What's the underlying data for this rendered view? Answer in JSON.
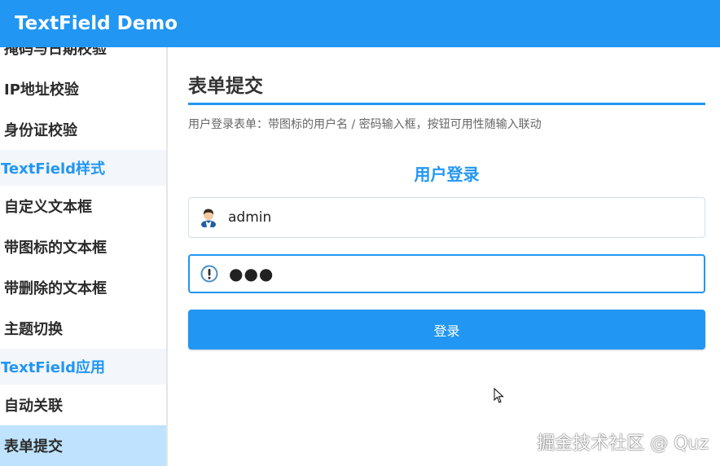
{
  "appbar": {
    "title": "TextField Demo"
  },
  "sidebar": {
    "items": [
      {
        "label": "掩码与日期校验",
        "type": "item"
      },
      {
        "label": "IP地址校验",
        "type": "item"
      },
      {
        "label": "身份证校验",
        "type": "item"
      },
      {
        "label": "TextField样式",
        "type": "header"
      },
      {
        "label": "自定义文本框",
        "type": "item"
      },
      {
        "label": "带图标的文本框",
        "type": "item"
      },
      {
        "label": "带删除的文本框",
        "type": "item"
      },
      {
        "label": "主题切换",
        "type": "item"
      },
      {
        "label": "TextField应用",
        "type": "header"
      },
      {
        "label": "自动关联",
        "type": "item"
      },
      {
        "label": "表单提交",
        "type": "item",
        "active": true
      }
    ]
  },
  "main": {
    "title": "表单提交",
    "description": "用户登录表单：带图标的用户名 / 密码输入框，按钮可用性随输入联动",
    "form": {
      "title": "用户登录",
      "username": {
        "value": "admin",
        "icon": "user-icon"
      },
      "password": {
        "value": "●●●",
        "icon": "password-info-icon"
      },
      "submit_label": "登录"
    }
  },
  "watermark": "掘金技术社区 @ Quz",
  "colors": {
    "accent": "#2196f3",
    "active_item_bg": "#bfe3ff",
    "header_bg": "#f3f6fa"
  }
}
